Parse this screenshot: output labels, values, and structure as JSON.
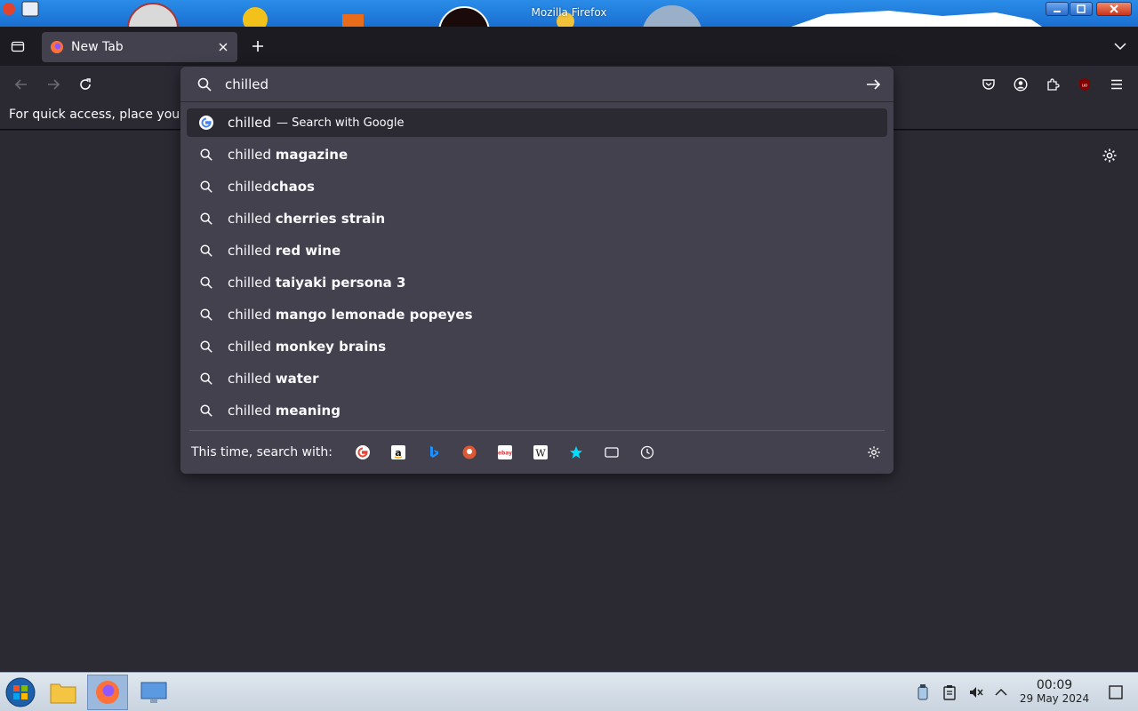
{
  "window": {
    "title": "Mozilla Firefox"
  },
  "tabs": [
    {
      "label": "New Tab"
    }
  ],
  "bookmarks_bar": {
    "text": "For quick access, place your"
  },
  "urlbar": {
    "value": "chilled",
    "heuristic": {
      "text": "chilled",
      "action": "— Search with Google"
    },
    "suggestions": [
      {
        "prefix": "chilled ",
        "bold": "magazine"
      },
      {
        "prefix": "chilled",
        "bold": "chaos"
      },
      {
        "prefix": "chilled ",
        "bold": "cherries strain"
      },
      {
        "prefix": "chilled ",
        "bold": "red wine"
      },
      {
        "prefix": "chilled ",
        "bold": "taiyaki persona 3"
      },
      {
        "prefix": "chilled ",
        "bold": "mango lemonade popeyes"
      },
      {
        "prefix": "chilled ",
        "bold": "monkey brains"
      },
      {
        "prefix": "chilled ",
        "bold": "water"
      },
      {
        "prefix": "chilled ",
        "bold": "meaning"
      }
    ],
    "one_off_label": "This time, search with:",
    "engines": [
      "google-icon",
      "amazon-icon",
      "bing-icon",
      "duckduckgo-icon",
      "ebay-icon",
      "wikipedia-icon",
      "bookmarks-star-icon",
      "tabs-icon",
      "history-icon"
    ]
  },
  "taskbar": {
    "time": "00:09",
    "date": "29 May 2024"
  },
  "colors": {
    "accent": "#1a6fd0",
    "panel": "#42414d",
    "toolbar": "#2b2a33",
    "tabstrip": "#1c1b22"
  }
}
